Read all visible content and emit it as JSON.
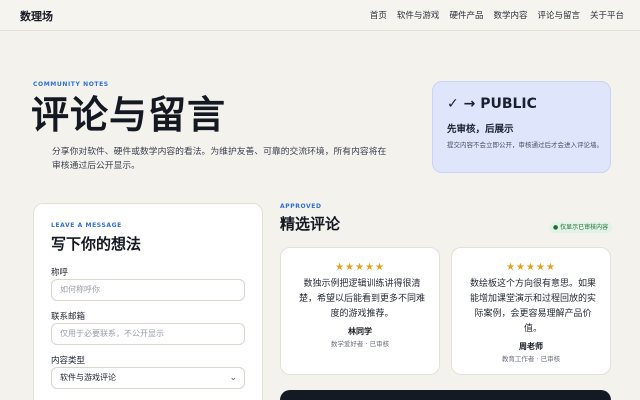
{
  "header": {
    "brand": "数理场",
    "nav": [
      "首页",
      "软件与游戏",
      "硬件产品",
      "数学内容",
      "评论与留言",
      "关于平台"
    ]
  },
  "hero": {
    "eyebrow": "COMMUNITY NOTES",
    "title": "评论与留言",
    "description": "分享你对软件、硬件或数学内容的看法。为维护友善、可靠的交流环境，所有内容将在审核通过后公开显示。"
  },
  "public_card": {
    "title": "✓ → PUBLIC",
    "subtitle": "先审核，后展示",
    "note": "提交内容不会立即公开，审核通过后才会进入评论墙。"
  },
  "form": {
    "eyebrow": "LEAVE A MESSAGE",
    "title": "写下你的想法",
    "name_label": "称呼",
    "name_placeholder": "如何称呼你",
    "email_label": "联系邮箱",
    "email_placeholder": "仅用于必要联系，不公开显示",
    "type_label": "内容类型",
    "type_value": "软件与游戏评论"
  },
  "approved": {
    "eyebrow": "APPROVED",
    "title": "精选评论",
    "badge": "● 仅显示已审核内容",
    "reviews": [
      {
        "stars": "★★★★★",
        "text": "数独示例把逻辑训练讲得很清楚，希望以后能看到更多不同难度的游戏推荐。",
        "name": "林同学",
        "role": "数学爱好者 · 已审核"
      },
      {
        "stars": "★★★★★",
        "text": "数绘板这个方向很有意思。如果能增加课堂演示和过程回放的实际案例，会更容易理解产品价值。",
        "name": "周老师",
        "role": "教育工作者 · 已审核"
      }
    ]
  }
}
